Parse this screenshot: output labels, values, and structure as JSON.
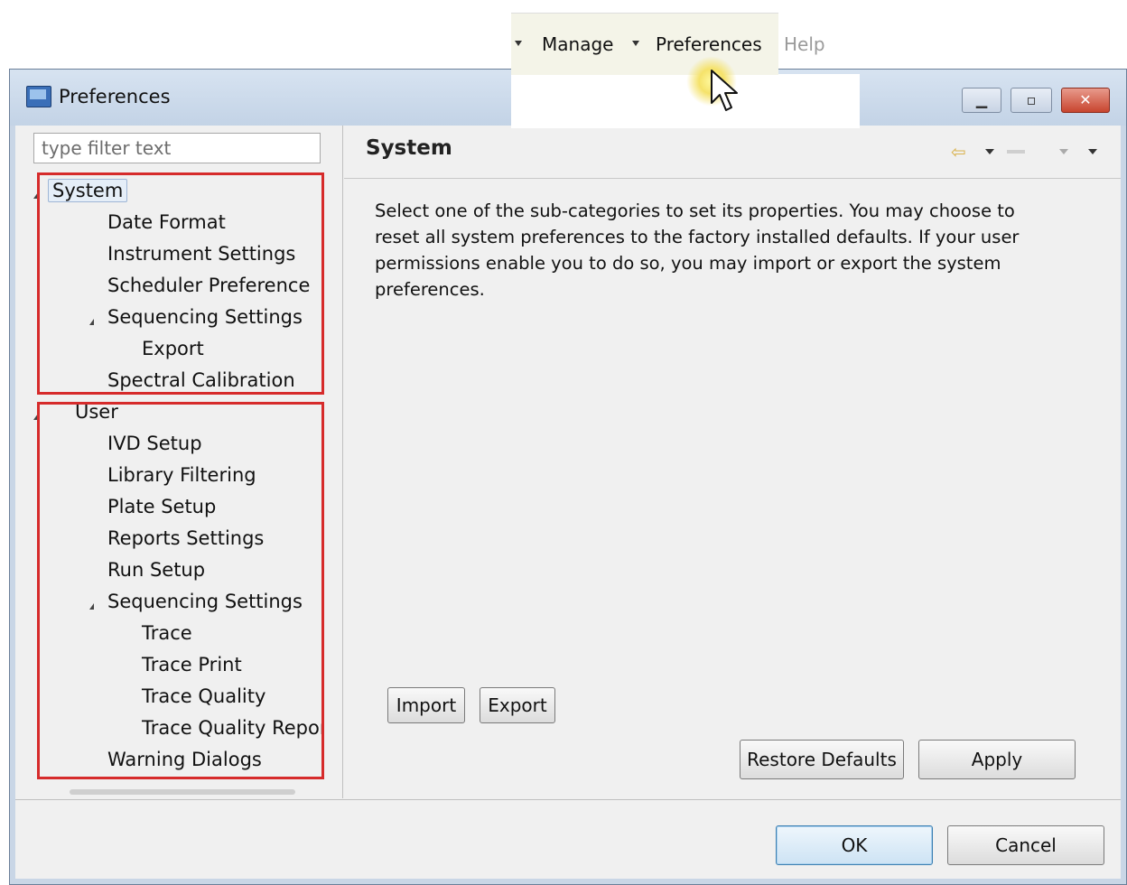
{
  "menubar": {
    "items": [
      {
        "label": "Manage"
      },
      {
        "label": "Preferences"
      },
      {
        "label": "Help"
      }
    ]
  },
  "window": {
    "title": "Preferences",
    "controls": {
      "minimize_icon": "minimize-icon",
      "maximize_icon": "maximize-icon",
      "close_icon": "close-icon"
    }
  },
  "filter": {
    "placeholder": "type filter text",
    "value": ""
  },
  "tree": {
    "system": {
      "label": "System",
      "children": [
        "Date Format",
        "Instrument Settings",
        "Scheduler Preference"
      ],
      "sequencing": {
        "label": "Sequencing Settings",
        "children": [
          "Export"
        ]
      },
      "last": "Spectral Calibration"
    },
    "user": {
      "label": "User",
      "children": [
        "IVD Setup",
        "Library Filtering",
        "Plate Setup",
        "Reports Settings",
        "Run Setup"
      ],
      "sequencing": {
        "label": "Sequencing Settings",
        "children": [
          "Trace",
          "Trace Print",
          "Trace Quality",
          "Trace Quality Repor"
        ]
      },
      "last": "Warning Dialogs"
    }
  },
  "page": {
    "title": "System",
    "description": "Select one of the sub-categories to set its properties.  You may choose to reset all system preferences to the factory installed defaults.  If your user permissions enable you to do so, you may import or export the system preferences.",
    "import_label": "Import",
    "export_label": "Export",
    "restore_label": "Restore Defaults",
    "apply_label": "Apply"
  },
  "dialog_buttons": {
    "ok_label": "OK",
    "cancel_label": "Cancel"
  },
  "colors": {
    "highlight_box": "#d62b2b",
    "selection": "#e5eef8"
  }
}
